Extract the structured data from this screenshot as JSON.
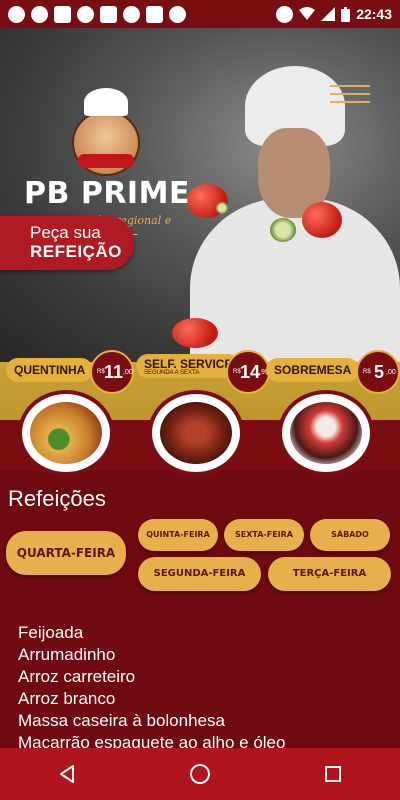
{
  "status_bar": {
    "time": "22:43",
    "left_icons": [
      "minus-circle-icon",
      "facebook-icon",
      "mail-icon",
      "telegram-icon",
      "discord-icon",
      "whatsapp-icon",
      "twitter-icon",
      "pinwheel-icon"
    ],
    "right_icons": [
      "dnd-icon",
      "wifi-icon",
      "signal-icon",
      "battery-icon"
    ]
  },
  "header": {
    "brand": "PB PRIME",
    "tagline": "cozinha regional e oriental",
    "order_line1": "Peça sua",
    "order_line2": "REFEIÇÃO"
  },
  "products": [
    {
      "tag": "QUENTINHA",
      "subtag": "",
      "currency": "R$",
      "price_int": "11",
      "price_dec": ",00"
    },
    {
      "tag": "SELF. SERVICE",
      "subtag": "SEGUNDA A SEXTA",
      "currency": "R$",
      "price_int": "14",
      "price_dec": ",99"
    },
    {
      "tag": "SOBREMESA",
      "subtag": "",
      "currency": "R$",
      "price_int": "5",
      "price_dec": ",00"
    }
  ],
  "menu_section": {
    "title": "Refeições",
    "days": {
      "quarta": "QUARTA-FEIRA",
      "quinta": "QUINTA-FEIRA",
      "sexta": "SEXTA-FEIRA",
      "sabado": "SÁBADO",
      "segunda": "SEGUNDA-FEIRA",
      "terca": "TERÇA-FEIRA"
    },
    "items": [
      "Feijoada",
      "Arrumadinho",
      "Arroz carreteiro",
      "Arroz branco",
      "Massa caseira à bolonhesa",
      "Macarrão espaguete ao alho e óleo"
    ]
  },
  "colors": {
    "brand_red": "#7a0d12",
    "accent_gold": "#e8b04a",
    "nav_red": "#b0151d"
  }
}
